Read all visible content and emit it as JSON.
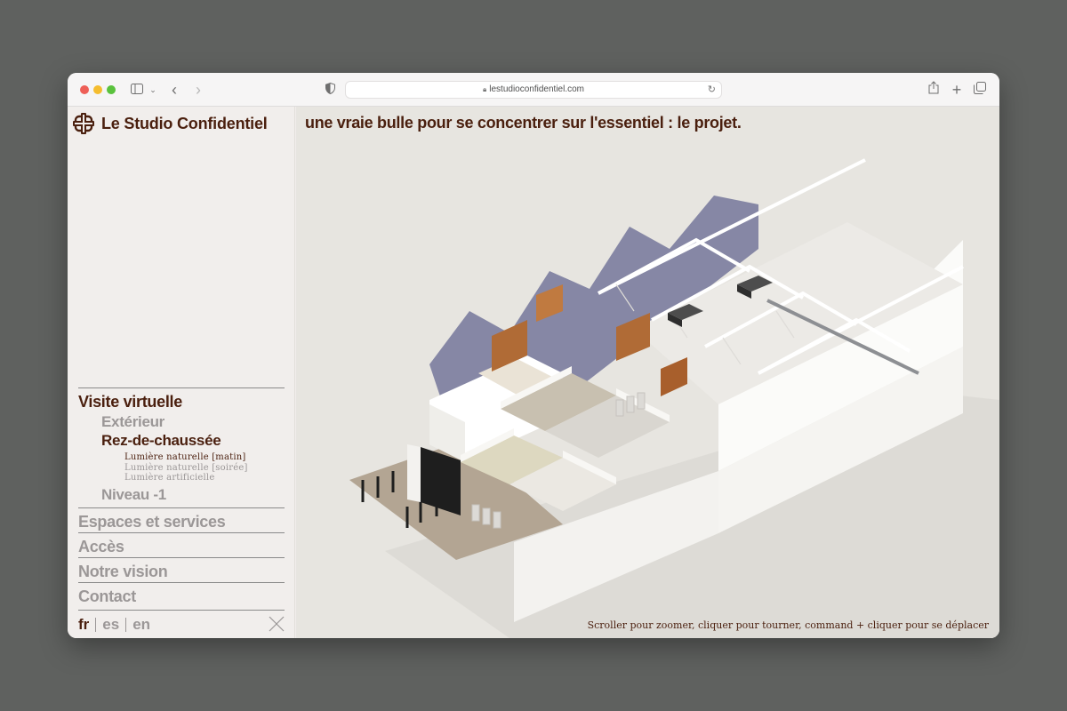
{
  "browser": {
    "url": "lestudioconfidentiel.com",
    "icons": {
      "sidebar": "sidebar-icon",
      "back": "chevron-left-icon",
      "forward": "chevron-right-icon",
      "privacy": "shield-icon",
      "lock": "lock-icon",
      "reload": "reload-icon",
      "share": "share-icon",
      "new_tab": "plus-icon",
      "tabs": "tabs-icon"
    }
  },
  "brand": {
    "name": "Le Studio Confidentiel",
    "color": "#4a1f0e"
  },
  "tagline": "une vraie bulle pour se concentrer sur l'essentiel : le projet.",
  "nav": {
    "visite": "Visite virtuelle",
    "exterieur": "Extérieur",
    "rdc": "Rez-de-chaussée",
    "lights": [
      "Lumière naturelle [matin]",
      "Lumière naturelle [soirée]",
      "Lumière artificielle"
    ],
    "niveau": "Niveau -1",
    "espaces": "Espaces et services",
    "acces": "Accès",
    "vision": "Notre vision",
    "contact": "Contact"
  },
  "languages": [
    "fr",
    "es",
    "en"
  ],
  "active_language": "fr",
  "hint": "Scroller pour zoomer, cliquer pour tourner, command + cliquer pour se déplacer",
  "colors": {
    "accent": "#4a1f0e",
    "muted": "#9b9797",
    "scene_bg": "#e7e5e0"
  }
}
